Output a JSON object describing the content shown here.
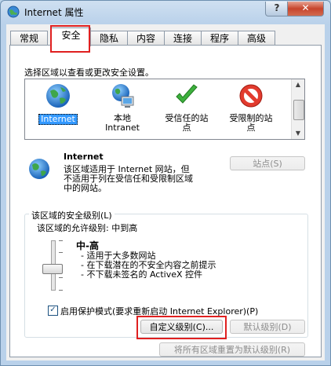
{
  "window": {
    "title": "Internet 属性",
    "help_label": "?",
    "close_label": "✕"
  },
  "tabs": [
    {
      "label": "常规",
      "active": false
    },
    {
      "label": "安全",
      "active": true
    },
    {
      "label": "隐私",
      "active": false
    },
    {
      "label": "内容",
      "active": false
    },
    {
      "label": "连接",
      "active": false
    },
    {
      "label": "程序",
      "active": false
    },
    {
      "label": "高级",
      "active": false
    }
  ],
  "security": {
    "zone_prompt": "选择区域以查看或更改安全设置。",
    "zones": [
      {
        "label": "Internet",
        "icon": "globe-icon",
        "selected": true
      },
      {
        "label": "本地\nIntranet",
        "icon": "local-intranet-icon",
        "selected": false
      },
      {
        "label": "受信任的站\n点",
        "icon": "green-check-icon",
        "selected": false
      },
      {
        "label": "受限制的站\n点",
        "icon": "red-prohibited-icon",
        "selected": false
      }
    ],
    "zone_info": {
      "name": "Internet",
      "description": "该区域适用于 Internet 网站，但\n不适用于列在受信任和受限制区域\n中的网站。",
      "sites_button": "站点(S)"
    },
    "level_group": {
      "legend": "该区域的安全级别(L)",
      "allowed": "该区域的允许级别: 中到高",
      "level_name": "中-高",
      "bullets": [
        "- 适用于大多数网站",
        "- 在下载潜在的不安全内容之前提示",
        "- 不下载未签名的 ActiveX 控件"
      ],
      "slider_level_index": 2,
      "slider_levels": 5
    },
    "protected_mode": {
      "label": "启用保护模式(要求重新启动 Internet Explorer)(P)",
      "checked": true
    },
    "buttons": {
      "custom_level": "自定义级别(C)...",
      "default_level": "默认级别(D)",
      "reset_all": "将所有区域重置为默认级别(R)"
    }
  },
  "colors": {
    "highlight_red": "#e02020",
    "selection_blue": "#3399ff"
  }
}
